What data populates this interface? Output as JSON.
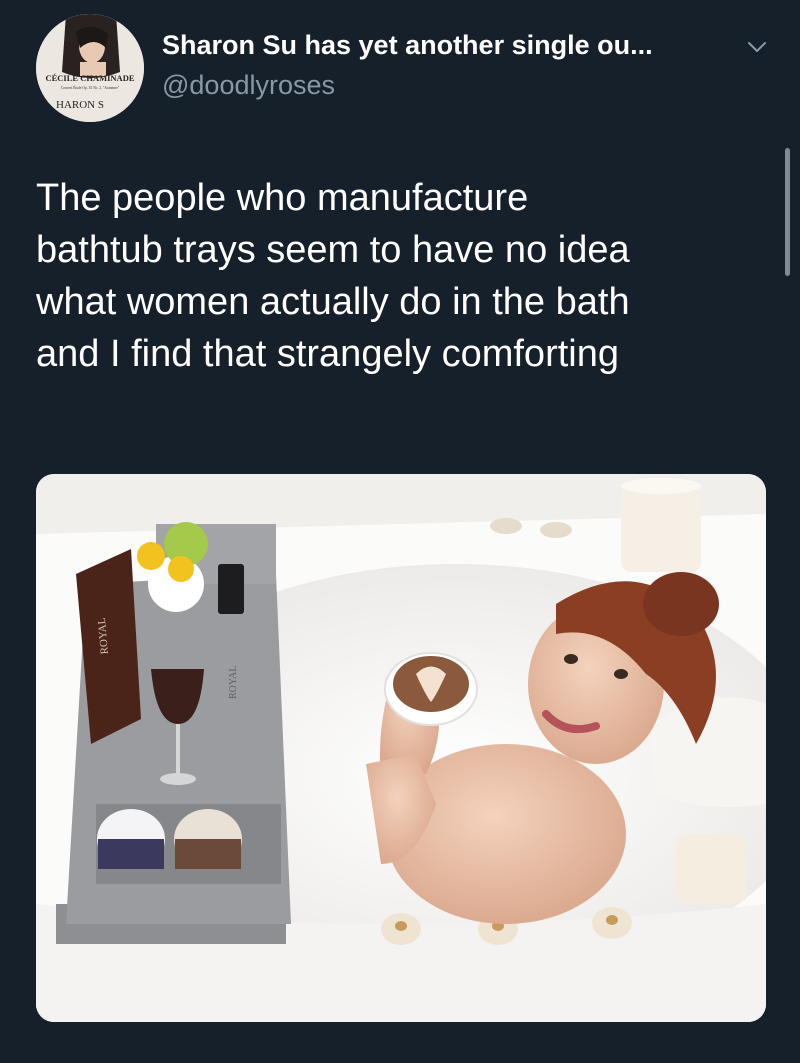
{
  "tweet": {
    "display_name": "Sharon Su has yet another single ou...",
    "handle": "@doodlyroses",
    "text_lines": [
      "The people who manufacture",
      "bathtub trays seem to have no idea",
      "what women actually do in the bath",
      "and I find that strangely comforting"
    ]
  },
  "avatar": {
    "line1": "CÉCILE CHAMINADE",
    "line2": "Concert Étude Op. 35 No. 2, \"Automne\"",
    "line3": "HARON S"
  },
  "photo": {
    "brand_on_book": "ROYAL",
    "brand_on_tray": "ROYAL"
  },
  "colors": {
    "background": "#15202b",
    "secondary_text": "#8899a6"
  },
  "icons": {
    "chevron": "chevron-down-icon"
  }
}
